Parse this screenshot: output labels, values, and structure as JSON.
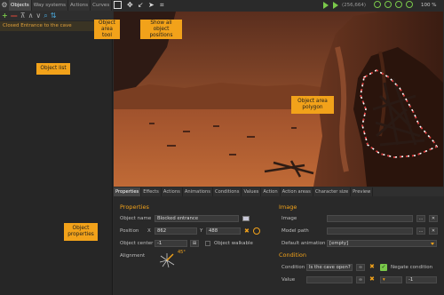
{
  "left_panel": {
    "tabs": [
      "Objects",
      "Way systems",
      "Actions",
      "Curves"
    ],
    "selected_item": "Closed Entrance to the cave"
  },
  "toolbar": {
    "coordinates": "(256,664)",
    "zoom": "100 %"
  },
  "callouts": {
    "area_tool": "Object area tool",
    "show_positions": "Show all object positions",
    "object_list": "Object list",
    "object_area_polygon": "Object area polygon",
    "object_properties": "Object properties"
  },
  "property_tabs": [
    "Properties",
    "Effects",
    "Actions",
    "Animations",
    "Conditions",
    "Values",
    "Action",
    "Action areas",
    "Character size",
    "Preview"
  ],
  "properties": {
    "heading": "Properties",
    "object_name_label": "Object name",
    "object_name": "Blocked entrance",
    "position_label": "Position",
    "x_label": "X",
    "x_value": "862",
    "y_label": "Y",
    "y_value": "488",
    "center_label": "Object center",
    "center_value": "-1",
    "walkable_label": "Object walkable",
    "alignment_label": "Alignment",
    "alignment_angle": "45°"
  },
  "image": {
    "heading": "Image",
    "image_label": "Image",
    "model_path_label": "Model path",
    "default_anim_label": "Default animation",
    "default_anim_value": "[empty]",
    "dots": "..."
  },
  "condition": {
    "heading": "Condition",
    "condition_label": "Condition",
    "condition_value": "Is the cave open?",
    "negate_label": "Negate condition",
    "value_label": "Value",
    "compare_value": "-1"
  },
  "colors": {
    "accent": "#f2a21a",
    "green": "#7ac94a",
    "red": "#e04a3a"
  }
}
